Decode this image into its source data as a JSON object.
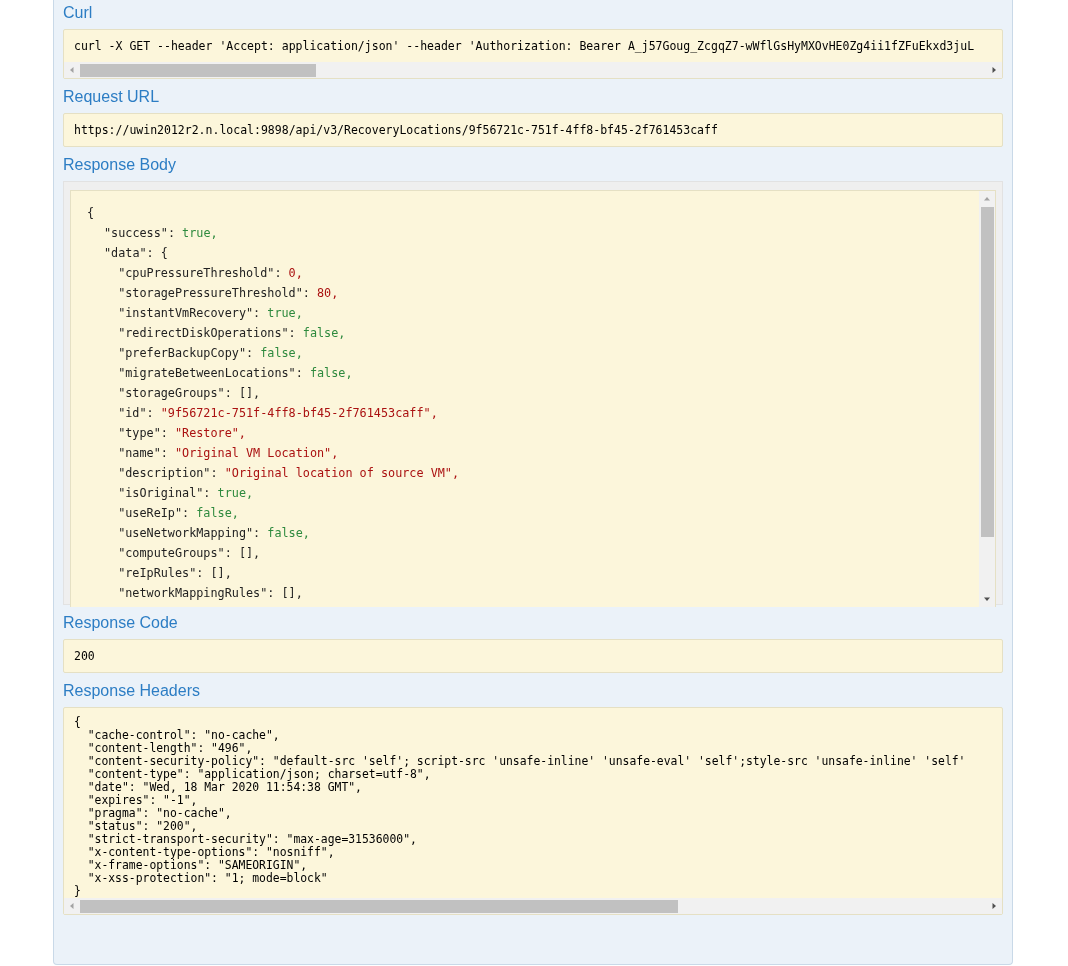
{
  "sections": [
    {
      "kind": "scroll_text",
      "title": "Curl",
      "text": "curl -X GET --header 'Accept: application/json' --header 'Authorization: Bearer A_j57Goug_ZcgqZ7-wWflGsHyMXOvHE0Zg4ii1fZFuEkxd3juL"
    },
    {
      "kind": "text",
      "title": "Request URL",
      "text": "https://uwin2012r2.n.local:9898/api/v3/RecoveryLocations/9f56721c-751f-4ff8-bf45-2f761453caff"
    },
    {
      "kind": "json",
      "title": "Response Body",
      "open": "{",
      "items": [
        {
          "key": "\"success\":",
          "value": "true,",
          "kind": "boolean"
        },
        {
          "key": "\"data\":",
          "value": "{",
          "kind": "punct",
          "children": [
            {
              "key": "\"cpuPressureThreshold\":",
              "value": "0,",
              "kind": "number"
            },
            {
              "key": "\"storagePressureThreshold\":",
              "value": "80,",
              "kind": "number"
            },
            {
              "key": "\"instantVmRecovery\":",
              "value": "true,",
              "kind": "boolean"
            },
            {
              "key": "\"redirectDiskOperations\":",
              "value": "false,",
              "kind": "boolean"
            },
            {
              "key": "\"preferBackupCopy\":",
              "value": "false,",
              "kind": "boolean"
            },
            {
              "key": "\"migrateBetweenLocations\":",
              "value": "false,",
              "kind": "boolean"
            },
            {
              "key": "\"storageGroups\":",
              "value": "[],",
              "kind": "punct"
            },
            {
              "key": "\"id\":",
              "value": "\"9f56721c-751f-4ff8-bf45-2f761453caff\",",
              "kind": "string"
            },
            {
              "key": "\"type\":",
              "value": "\"Restore\",",
              "kind": "string"
            },
            {
              "key": "\"name\":",
              "value": "\"Original VM Location\",",
              "kind": "string"
            },
            {
              "key": "\"description\":",
              "value": "\"Original location of source VM\",",
              "kind": "string"
            },
            {
              "key": "\"isOriginal\":",
              "value": "true,",
              "kind": "boolean"
            },
            {
              "key": "\"useReIp\":",
              "value": "false,",
              "kind": "boolean"
            },
            {
              "key": "\"useNetworkMapping\":",
              "value": "false,",
              "kind": "boolean"
            },
            {
              "key": "\"computeGroups\":",
              "value": "[],",
              "kind": "punct"
            },
            {
              "key": "\"reIpRules\":",
              "value": "[],",
              "kind": "punct"
            },
            {
              "key": "\"networkMappingRules\":",
              "value": "[],",
              "kind": "punct"
            }
          ]
        }
      ]
    },
    {
      "kind": "text",
      "title": "Response Code",
      "text": "200"
    },
    {
      "kind": "headers",
      "title": "Response Headers",
      "open": "{",
      "close": "}",
      "items": [
        "\"cache-control\": \"no-cache\",",
        "\"content-length\": \"496\",",
        "\"content-security-policy\": \"default-src 'self'; script-src 'unsafe-inline' 'unsafe-eval' 'self';style-src 'unsafe-inline' 'self'",
        "\"content-type\": \"application/json; charset=utf-8\",",
        "\"date\": \"Wed, 18 Mar 2020 11:54:38 GMT\",",
        "\"expires\": \"-1\",",
        "\"pragma\": \"no-cache\",",
        "\"status\": \"200\",",
        "\"strict-transport-security\": \"max-age=31536000\",",
        "\"x-content-type-options\": \"nosniff\",",
        "\"x-frame-options\": \"SAMEORIGIN\",",
        "\"x-xss-protection\": \"1; mode=block\""
      ]
    }
  ]
}
